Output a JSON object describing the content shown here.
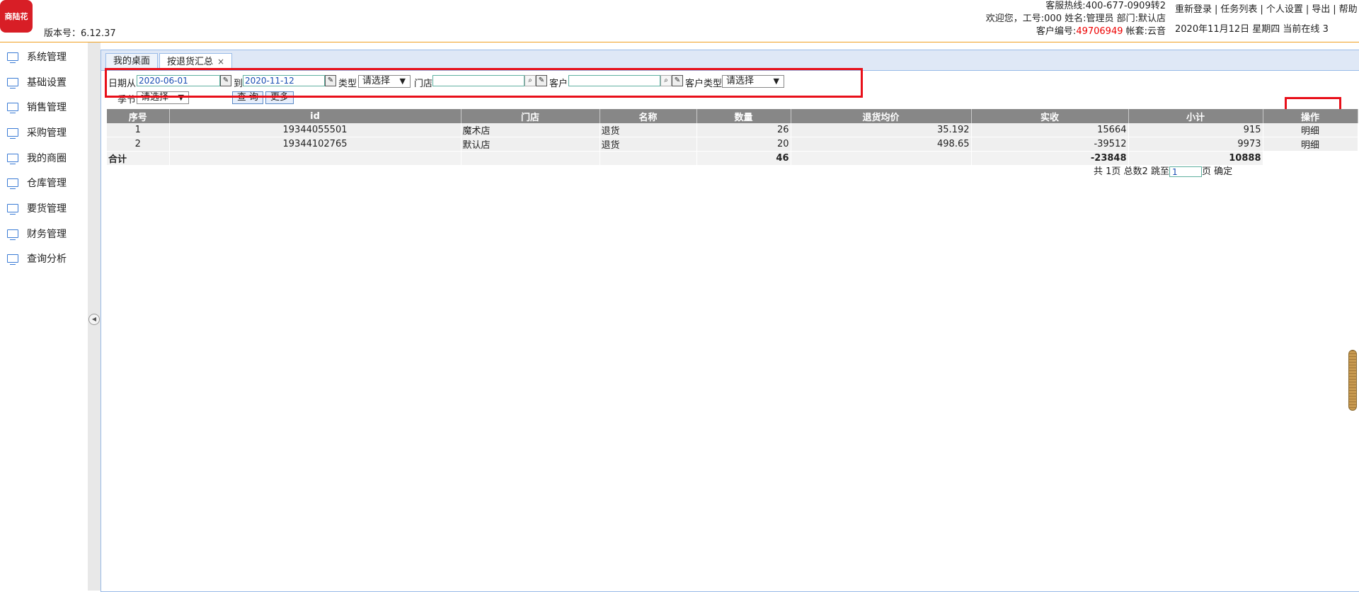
{
  "header": {
    "logo_text": "商陆花",
    "version": "版本号：6.12.37",
    "hotline": "客服热线:400-677-0909转2",
    "welcome": "欢迎您，工号:000 姓名:管理员 部门:默认店",
    "customer_prefix": "客户编号:",
    "customer_no": "49706949",
    "account": " 帐套:云音",
    "links": [
      "重新登录",
      "任务列表",
      "个人设置",
      "导出",
      "帮助"
    ],
    "date_line": "2020年11月12日 星期四 当前在线 3"
  },
  "sidebar": {
    "items": [
      "系统管理",
      "基础设置",
      "销售管理",
      "采购管理",
      "我的商圈",
      "仓库管理",
      "要货管理",
      "财务管理",
      "查询分析"
    ]
  },
  "tabs": [
    {
      "label": "我的桌面"
    },
    {
      "label": "按退货汇总",
      "close": "×"
    }
  ],
  "filters": {
    "date_from_label": "日期从",
    "date_from": "2020-06-01",
    "date_to_label": "到",
    "date_to": "2020-11-12",
    "type_label": "类型",
    "type_value": "请选择",
    "store_label": "门店",
    "store_value": "",
    "customer_label": "客户",
    "customer_value": "",
    "customer_type_label": "客户类型",
    "customer_type_value": "请选择",
    "season_label": "季节",
    "season_value": "请选择",
    "query_button": "查 询",
    "more_button": "更多",
    "arrow": "▼"
  },
  "table": {
    "columns": [
      "序号",
      "id",
      "门店",
      "名称",
      "数量",
      "退货均价",
      "实收",
      "小计",
      "操作"
    ],
    "rows": [
      [
        "1",
        "19344055501",
        "魔术店",
        "退货",
        "26",
        "35.192",
        "15664",
        "915",
        "明细"
      ],
      [
        "2",
        "19344102765",
        "默认店",
        "退货",
        "20",
        "498.65",
        "-39512",
        "9973",
        "明细"
      ]
    ],
    "total": {
      "label": "合计",
      "quantity": "46",
      "received": "-23848",
      "subtotal": "10888"
    }
  },
  "pager": {
    "text_before": "共 1页 总数2 跳至",
    "page_input": "1",
    "text_after": "页 确定"
  },
  "colors": {
    "accent_line": "#f0a020",
    "highlight_box": "#e8101a",
    "table_header": "#878787",
    "logo": "#d81e26"
  }
}
